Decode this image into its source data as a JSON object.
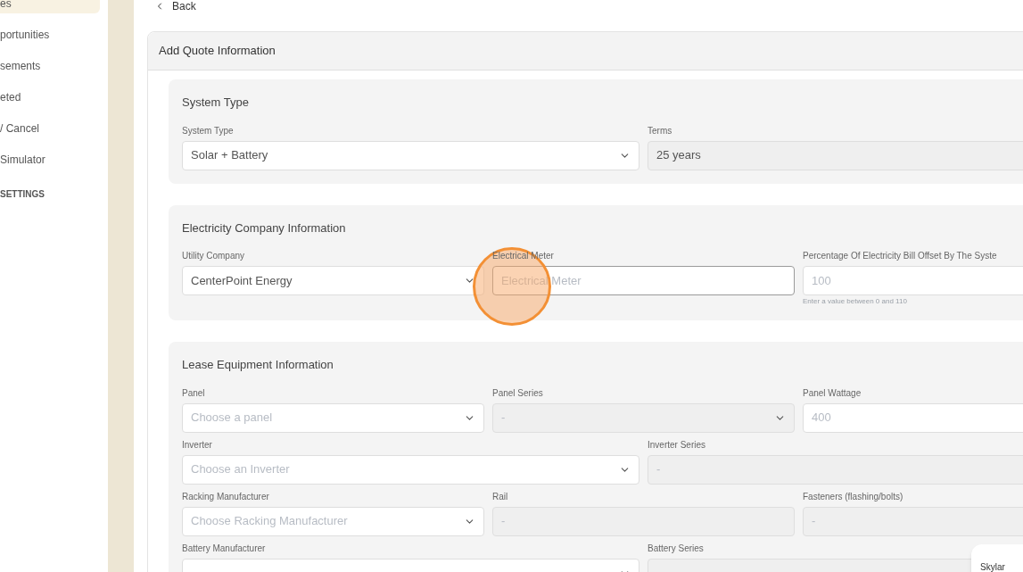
{
  "sidebar": {
    "items": [
      {
        "label": "es",
        "selected": true
      },
      {
        "label": "portunities",
        "selected": false
      },
      {
        "label": "sements",
        "selected": false
      },
      {
        "label": "eted",
        "selected": false
      },
      {
        "label": "/ Cancel",
        "selected": false
      },
      {
        "label": "Simulator",
        "selected": false
      }
    ],
    "section_heading": "SETTINGS"
  },
  "back_link": "Back",
  "card": {
    "title": "Add Quote Information",
    "sections": [
      {
        "title": "System Type",
        "rows": [
          [
            {
              "label": "System Type",
              "kind": "select",
              "value": "Solar + Battery",
              "disabled": false
            },
            {
              "label": "Terms",
              "kind": "input",
              "value": "25 years",
              "disabled": true
            }
          ]
        ]
      },
      {
        "title": "Electricity Company Information",
        "rows": [
          [
            {
              "label": "Utility Company",
              "kind": "select",
              "value": "CenterPoint Energy",
              "disabled": false
            },
            {
              "label": "Electrical Meter",
              "kind": "input",
              "placeholder": "Electrical Meter",
              "disabled": false,
              "focused": true
            },
            {
              "label": "Percentage Of Electricity Bill Offset By The Syste",
              "kind": "input",
              "placeholder": "100",
              "disabled": false,
              "hint": "Enter a value between 0 and 110"
            }
          ]
        ]
      },
      {
        "title": "Lease Equipment Information",
        "rows": [
          [
            {
              "label": "Panel",
              "kind": "select",
              "placeholder": "Choose a panel",
              "disabled": false
            },
            {
              "label": "Panel Series",
              "kind": "select",
              "placeholder": "-",
              "disabled": true
            },
            {
              "label": "Panel Wattage",
              "kind": "input",
              "placeholder": "400",
              "disabled": false
            }
          ],
          [
            {
              "label": "Inverter",
              "kind": "select",
              "placeholder": "Choose an Inverter",
              "disabled": false
            },
            {
              "label": "Inverter Series",
              "kind": "input",
              "placeholder": "-",
              "disabled": true
            }
          ],
          [
            {
              "label": "Racking Manufacturer",
              "kind": "select",
              "placeholder": "Choose Racking Manufacturer",
              "disabled": false
            },
            {
              "label": "Rail",
              "kind": "input",
              "placeholder": "-",
              "disabled": true
            },
            {
              "label": "Fasteners (flashing/bolts)",
              "kind": "input",
              "placeholder": "-",
              "disabled": true
            }
          ],
          [
            {
              "label": "Battery Manufacturer",
              "kind": "select",
              "disabled": false
            },
            {
              "label": "Battery Series",
              "kind": "input",
              "disabled": true
            }
          ]
        ]
      }
    ]
  },
  "click_indicator": true,
  "chat_widget": {
    "label": "Skylar"
  }
}
